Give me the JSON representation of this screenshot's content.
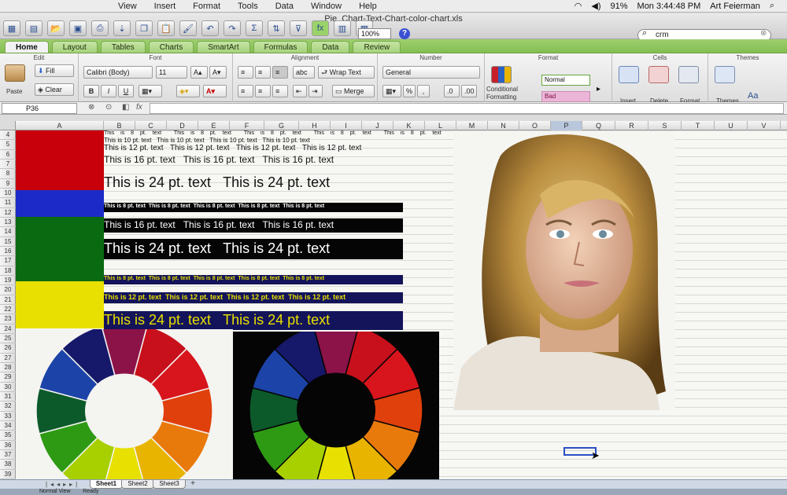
{
  "menubar": {
    "items": [
      "View",
      "Insert",
      "Format",
      "Tools",
      "Data",
      "Window",
      "Help"
    ],
    "battery": "91%",
    "clock": "Mon 3:44:48 PM",
    "user": "Art Feierman"
  },
  "toolbar": {
    "doc_title": "Pie_Chart-Text-Chart-color-chart.xls",
    "zoom": "100%",
    "search_value": "crm"
  },
  "ribbon_tabs": [
    "Home",
    "Layout",
    "Tables",
    "Charts",
    "SmartArt",
    "Formulas",
    "Data",
    "Review"
  ],
  "ribbon": {
    "edit": {
      "title": "Edit",
      "paste": "Paste",
      "fill": "Fill",
      "clear": "Clear"
    },
    "font": {
      "title": "Font",
      "family": "Calibri (Body)",
      "size": "11",
      "bold": "B",
      "italic": "I",
      "underline": "U"
    },
    "alignment": {
      "title": "Alignment",
      "abc": "abc",
      "wrap": "Wrap Text",
      "merge": "Merge"
    },
    "number": {
      "title": "Number",
      "format": "General",
      "percent": "%",
      "comma": ","
    },
    "format": {
      "title": "Format",
      "cond_label_1": "Conditional",
      "cond_label_2": "Formatting",
      "normal": "Normal",
      "bad": "Bad"
    },
    "cells": {
      "title": "Cells",
      "insert": "Insert",
      "delete": "Delete",
      "format": "Format"
    },
    "themes": {
      "title": "Themes",
      "themes": "Themes",
      "fonts": "Aa"
    }
  },
  "formula_bar": {
    "name_box": "P36",
    "fx": "fx"
  },
  "grid": {
    "columns": [
      "A",
      "B",
      "C",
      "D",
      "E",
      "F",
      "G",
      "H",
      "I",
      "J",
      "K",
      "L",
      "M",
      "N",
      "O",
      "P",
      "Q",
      "R",
      "S",
      "T",
      "U",
      "V"
    ],
    "selected_column": "P",
    "rows": [
      "4",
      "5",
      "6",
      "7",
      "8",
      "9",
      "10",
      "11",
      "12",
      "13",
      "14",
      "15",
      "16",
      "17",
      "18",
      "19",
      "20",
      "21",
      "22",
      "23",
      "24",
      "25",
      "26",
      "27",
      "28",
      "29",
      "30",
      "31",
      "32",
      "33",
      "34",
      "35",
      "36",
      "37",
      "38",
      "39"
    ]
  },
  "text_samples": {
    "s8": "This is 8 pt. text",
    "s10": "This is 10 pt. text",
    "s12": "This is 12 pt. text",
    "s16": "This is 16 pt. text",
    "s24": "This is 24 pt. text"
  },
  "colors": {
    "red_block": "#c8000c",
    "blue_block": "#1c2ac8",
    "green_block": "#0a6a12",
    "yellow_block": "#e8e000",
    "black_bar": "#050505",
    "navy_bar": "#14145a",
    "yellow_text": "#e8e000",
    "selection": "#2a4fc4"
  },
  "sheet_tabs": [
    "Sheet1",
    "Sheet2",
    "Sheet3"
  ],
  "active_sheet": "Sheet1",
  "status": {
    "view": "Normal View",
    "ready": "Ready"
  }
}
